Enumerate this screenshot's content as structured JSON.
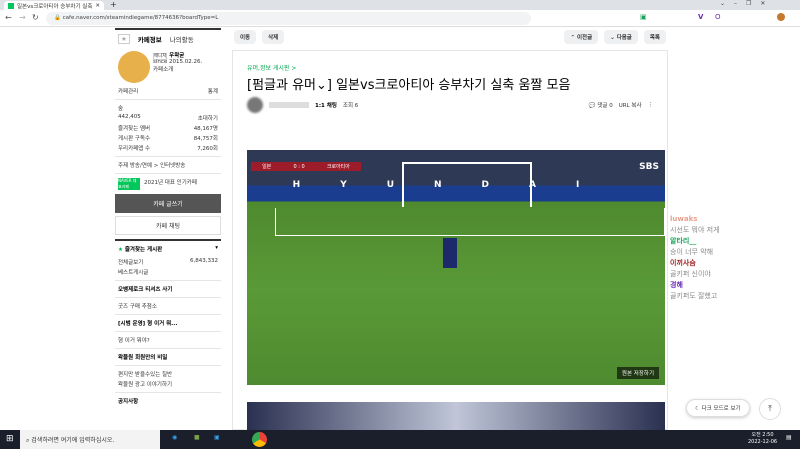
{
  "browser": {
    "tab_title": "일본vs크로아티아 승부차기 실축",
    "url": "cafe.naver.com/steamindiegame/8774636?boardType=L"
  },
  "sidebar": {
    "tabs": [
      "카페정보",
      "나의활동"
    ],
    "cafe_badge": "매니저",
    "cafe_manager": "우왁굳",
    "since": "since 2015.02.26.",
    "cafe_intro": "카페소개",
    "manage": "카페관리",
    "stats": "통계",
    "level": "숲",
    "members": "442,405",
    "invite": "초대하기",
    "stats_rows": [
      {
        "label": "즐겨찾는 멤버",
        "value": "48,167명"
      },
      {
        "label": "게시판 구독수",
        "value": "84,757회"
      },
      {
        "label": "우리카페앱 수",
        "value": "7,260회"
      }
    ],
    "topic": "주제 방송/연예 > 인터넷방송",
    "naver_badge": "NAVER 대표카페",
    "popular": "2021년 대표 인기카페",
    "write": "카페 글쓰기",
    "chat": "카페 채팅",
    "favorites": "즐겨찾는 게시판",
    "all_posts": "전체글보기",
    "all_count": "6,843,332",
    "best": "베스트게시글",
    "sec1": "오뱅제로크 티셔츠 사기",
    "goods": "굿즈 구매 추첨소",
    "sec2": "[시범 운영] 형 이거 뭐...",
    "what": "형 이거 뭐야?",
    "sec3": "왁물원 회원만의 비밀",
    "hidden1": "편지만 받을수있는 칠반",
    "hidden2": "왁물원 광고 이야기하기",
    "notice": "공지사항"
  },
  "main": {
    "move": "이동",
    "delete": "삭제",
    "prev": "이전글",
    "next": "다음글",
    "list": "목록",
    "board": "유머,정보 게시판 >",
    "title": "[펌글과 유머⌄] 일본vs크로아티아 승부차기 실축 움짤 모음",
    "chat_1to1": "1:1 채팅",
    "views": "조회 6",
    "comments": "댓글 0",
    "url_copy": "URL 복사",
    "save_video": "원본 저장하기",
    "score_home": "일본",
    "score_away": "크로아티아",
    "score": "0 : 0",
    "broadcaster": "SBS",
    "ad": "HYUNDAI",
    "dark_mode": "다크 모드로 보기"
  },
  "chat": [
    {
      "user": "luwaks",
      "msg": "시선도 뭐야 저게",
      "color": "#e8a090"
    },
    {
      "user": "알타리__",
      "msg": "승이 너무 약해",
      "color": "#1aa25a"
    },
    {
      "user": "이끼사슴",
      "msg": "골키퍼 신이야",
      "color": "#9b1c1c"
    },
    {
      "user": "경해",
      "msg": "골키퍼도 잘했고",
      "color": "#6a2bb0"
    }
  ],
  "taskbar": {
    "search": "검색하려면 여기에 입력하십시오.",
    "time": "오전 2:50",
    "date": "2022-12-06"
  }
}
